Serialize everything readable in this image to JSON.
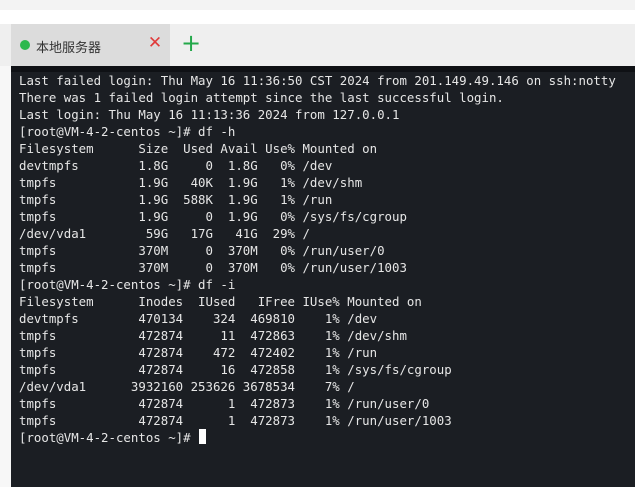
{
  "tab": {
    "title": "本地服务器",
    "close_glyph": "✕",
    "status_color": "#2db84d"
  },
  "add_tab_glyph": "+",
  "terminal": {
    "lines": [
      "Last failed login: Thu May 16 11:36:50 CST 2024 from 201.149.49.146 on ssh:notty",
      "There was 1 failed login attempt since the last successful login.",
      "Last login: Thu May 16 11:13:36 2024 from 127.0.0.1",
      "[root@VM-4-2-centos ~]# df -h",
      "Filesystem      Size  Used Avail Use% Mounted on",
      "devtmpfs        1.8G     0  1.8G   0% /dev",
      "tmpfs           1.9G   40K  1.9G   1% /dev/shm",
      "tmpfs           1.9G  588K  1.9G   1% /run",
      "tmpfs           1.9G     0  1.9G   0% /sys/fs/cgroup",
      "/dev/vda1        59G   17G   41G  29% /",
      "tmpfs           370M     0  370M   0% /run/user/0",
      "tmpfs           370M     0  370M   0% /run/user/1003",
      "[root@VM-4-2-centos ~]# df -i",
      "Filesystem      Inodes  IUsed   IFree IUse% Mounted on",
      "devtmpfs        470134    324  469810    1% /dev",
      "tmpfs           472874     11  472863    1% /dev/shm",
      "tmpfs           472874    472  472402    1% /run",
      "tmpfs           472874     16  472858    1% /sys/fs/cgroup",
      "/dev/vda1      3932160 253626 3678534    7% /",
      "tmpfs           472874      1  472873    1% /run/user/0",
      "tmpfs           472874      1  472873    1% /run/user/1003"
    ],
    "prompt": "[root@VM-4-2-centos ~]# "
  }
}
